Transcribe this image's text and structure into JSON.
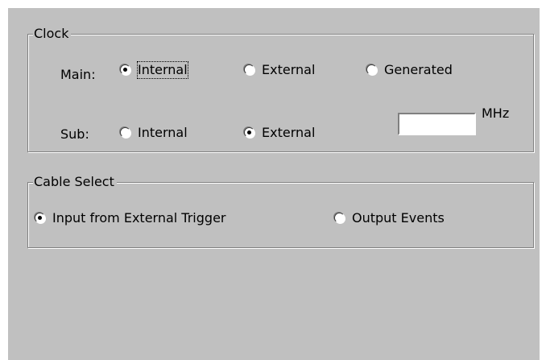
{
  "clock": {
    "title": "Clock",
    "main_label": "Main:",
    "sub_label": "Sub:",
    "main_options": [
      {
        "label": "Internal",
        "checked": true
      },
      {
        "label": "External",
        "checked": false
      },
      {
        "label": "Generated",
        "checked": false
      }
    ],
    "sub_options": [
      {
        "label": "Internal",
        "checked": false
      },
      {
        "label": "External",
        "checked": true
      }
    ],
    "frequency": {
      "value": "",
      "placeholder": "",
      "unit": "MHz"
    }
  },
  "cable_select": {
    "title": "Cable Select",
    "options": [
      {
        "label": "Input from External Trigger",
        "checked": true
      },
      {
        "label": "Output Events",
        "checked": false
      }
    ]
  },
  "colors": {
    "panel_background": "#c0c0c0",
    "page_background": "#ffffff",
    "groupbox_shadow": "#808080",
    "groupbox_highlight": "#ffffff"
  }
}
